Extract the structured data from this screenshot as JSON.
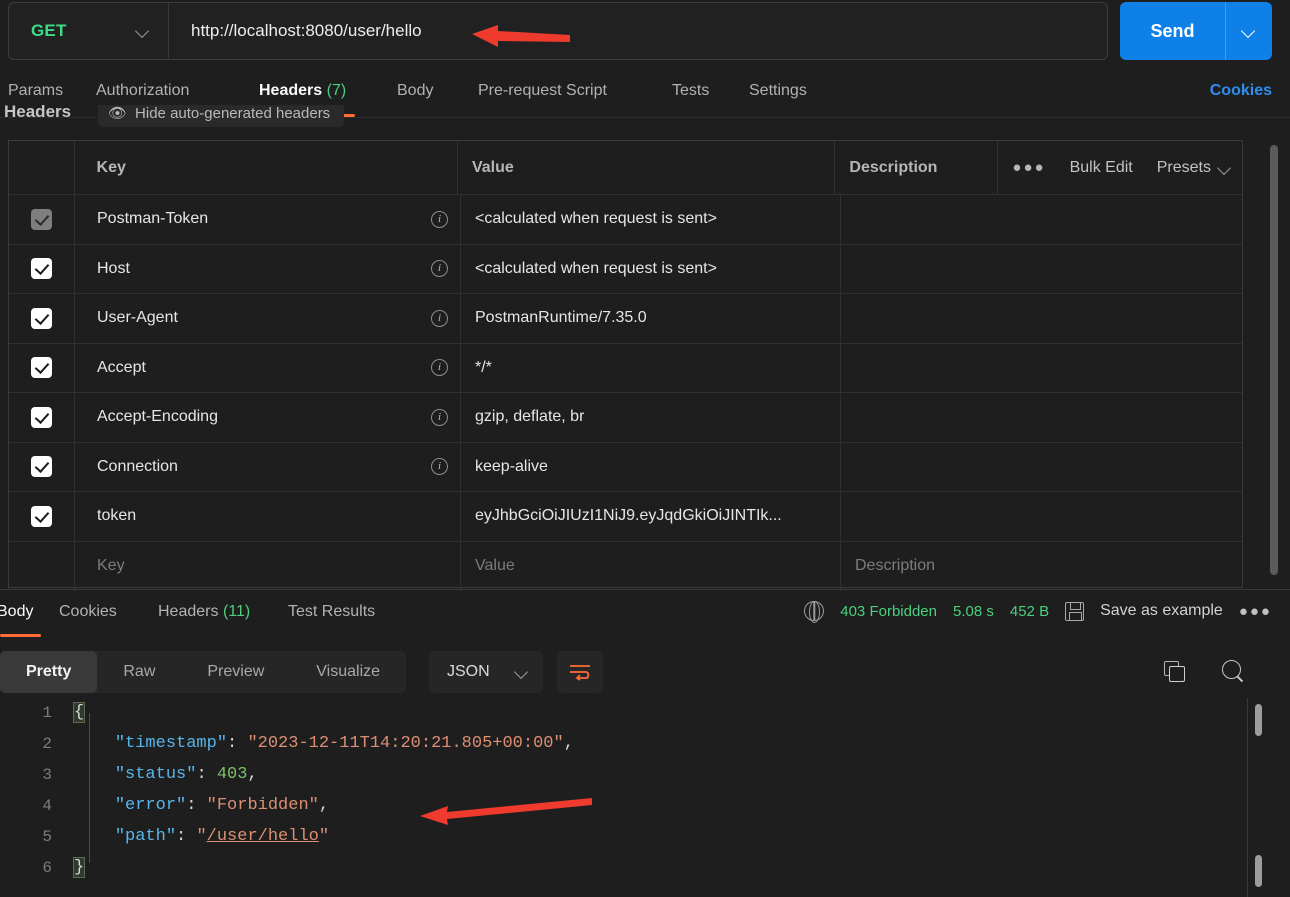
{
  "request": {
    "method": "GET",
    "method_icon": "chevron-down-icon",
    "url": "http://localhost:8080/user/hello",
    "send_label": "Send",
    "send_caret_icon": "chevron-down-icon",
    "tabs": [
      {
        "label": "Params",
        "count": "",
        "active": false
      },
      {
        "label": "Authorization",
        "count": "",
        "active": false
      },
      {
        "label": "Headers",
        "count": "(7)",
        "active": true
      },
      {
        "label": "Body",
        "count": "",
        "active": false
      },
      {
        "label": "Pre-request Script",
        "count": "",
        "active": false
      },
      {
        "label": "Tests",
        "count": "",
        "active": false
      },
      {
        "label": "Settings",
        "count": "",
        "active": false
      }
    ],
    "cookies_link": "Cookies"
  },
  "headers_section": {
    "caption": "Headers",
    "hide_auto_label": "Hide auto-generated headers",
    "eye_icon": "eye-off-icon",
    "columns": {
      "key": "Key",
      "value": "Value",
      "description": "Description"
    },
    "tools": {
      "more_icon": "ellipsis-icon",
      "bulk_edit": "Bulk Edit",
      "presets": "Presets",
      "presets_caret_icon": "chevron-down-icon"
    },
    "rows": [
      {
        "checked": true,
        "dim": true,
        "key": "Postman-Token",
        "info": true,
        "value": "<calculated when request is sent>",
        "description": ""
      },
      {
        "checked": true,
        "dim": false,
        "key": "Host",
        "info": true,
        "value": "<calculated when request is sent>",
        "description": ""
      },
      {
        "checked": true,
        "dim": false,
        "key": "User-Agent",
        "info": true,
        "value": "PostmanRuntime/7.35.0",
        "description": ""
      },
      {
        "checked": true,
        "dim": false,
        "key": "Accept",
        "info": true,
        "value": "*/*",
        "description": ""
      },
      {
        "checked": true,
        "dim": false,
        "key": "Accept-Encoding",
        "info": true,
        "value": "gzip, deflate, br",
        "description": ""
      },
      {
        "checked": true,
        "dim": false,
        "key": "Connection",
        "info": true,
        "value": "keep-alive",
        "description": ""
      },
      {
        "checked": true,
        "dim": false,
        "key": "token",
        "info": false,
        "value": "eyJhbGciOiJIUzI1NiJ9.eyJqdGkiOiJINTIk...",
        "description": ""
      }
    ],
    "placeholder_row": {
      "key": "Key",
      "value": "Value",
      "description": "Description"
    }
  },
  "response": {
    "tabs": [
      {
        "label": "Body",
        "count": "",
        "active": true
      },
      {
        "label": "Cookies",
        "count": "",
        "active": false
      },
      {
        "label": "Headers",
        "count": "(11)",
        "active": false
      },
      {
        "label": "Test Results",
        "count": "",
        "active": false
      }
    ],
    "globe_icon": "globe-icon",
    "status": "403 Forbidden",
    "time": "5.08 s",
    "size": "452 B",
    "save_icon": "floppy-disk-icon",
    "save_as_example": "Save as example",
    "more_icon": "ellipsis-icon",
    "view_tabs": [
      {
        "label": "Pretty",
        "active": true
      },
      {
        "label": "Raw",
        "active": false
      },
      {
        "label": "Preview",
        "active": false
      },
      {
        "label": "Visualize",
        "active": false
      }
    ],
    "format": "JSON",
    "format_caret_icon": "chevron-down-icon",
    "wrap_icon": "word-wrap-icon",
    "copy_icon": "copy-icon",
    "search_icon": "search-icon",
    "body_lines": [
      {
        "num": "1",
        "segments": [
          {
            "t": "{",
            "c": "k-brace"
          }
        ]
      },
      {
        "num": "2",
        "segments": [
          {
            "t": "    ",
            "c": "k-pun"
          },
          {
            "t": "\"timestamp\"",
            "c": "k-key"
          },
          {
            "t": ": ",
            "c": "k-pun"
          },
          {
            "t": "\"2023-12-11T14:20:21.805+00:00\"",
            "c": "k-str"
          },
          {
            "t": ",",
            "c": "k-pun"
          }
        ]
      },
      {
        "num": "3",
        "segments": [
          {
            "t": "    ",
            "c": "k-pun"
          },
          {
            "t": "\"status\"",
            "c": "k-key"
          },
          {
            "t": ": ",
            "c": "k-pun"
          },
          {
            "t": "403",
            "c": "k-num"
          },
          {
            "t": ",",
            "c": "k-pun"
          }
        ]
      },
      {
        "num": "4",
        "segments": [
          {
            "t": "    ",
            "c": "k-pun"
          },
          {
            "t": "\"error\"",
            "c": "k-key"
          },
          {
            "t": ": ",
            "c": "k-pun"
          },
          {
            "t": "\"Forbidden\"",
            "c": "k-str"
          },
          {
            "t": ",",
            "c": "k-pun"
          }
        ]
      },
      {
        "num": "5",
        "segments": [
          {
            "t": "    ",
            "c": "k-pun"
          },
          {
            "t": "\"path\"",
            "c": "k-key"
          },
          {
            "t": ": ",
            "c": "k-pun"
          },
          {
            "t": "\"",
            "c": "k-str"
          },
          {
            "t": "/user/hello",
            "c": "k-link"
          },
          {
            "t": "\"",
            "c": "k-str"
          }
        ]
      },
      {
        "num": "6",
        "segments": [
          {
            "t": "}",
            "c": "k-brace"
          }
        ]
      }
    ]
  },
  "annotations": {
    "arrow_color": "#ef3b2d",
    "arrows": [
      {
        "name": "url-arrow"
      },
      {
        "name": "error-line-arrow"
      }
    ]
  },
  "colors": {
    "accent_orange": "#ff6c37",
    "send_blue": "#0f80e8",
    "method_green": "#3ddc84",
    "status_green": "#4ad07d",
    "background": "#1e1e1e"
  }
}
